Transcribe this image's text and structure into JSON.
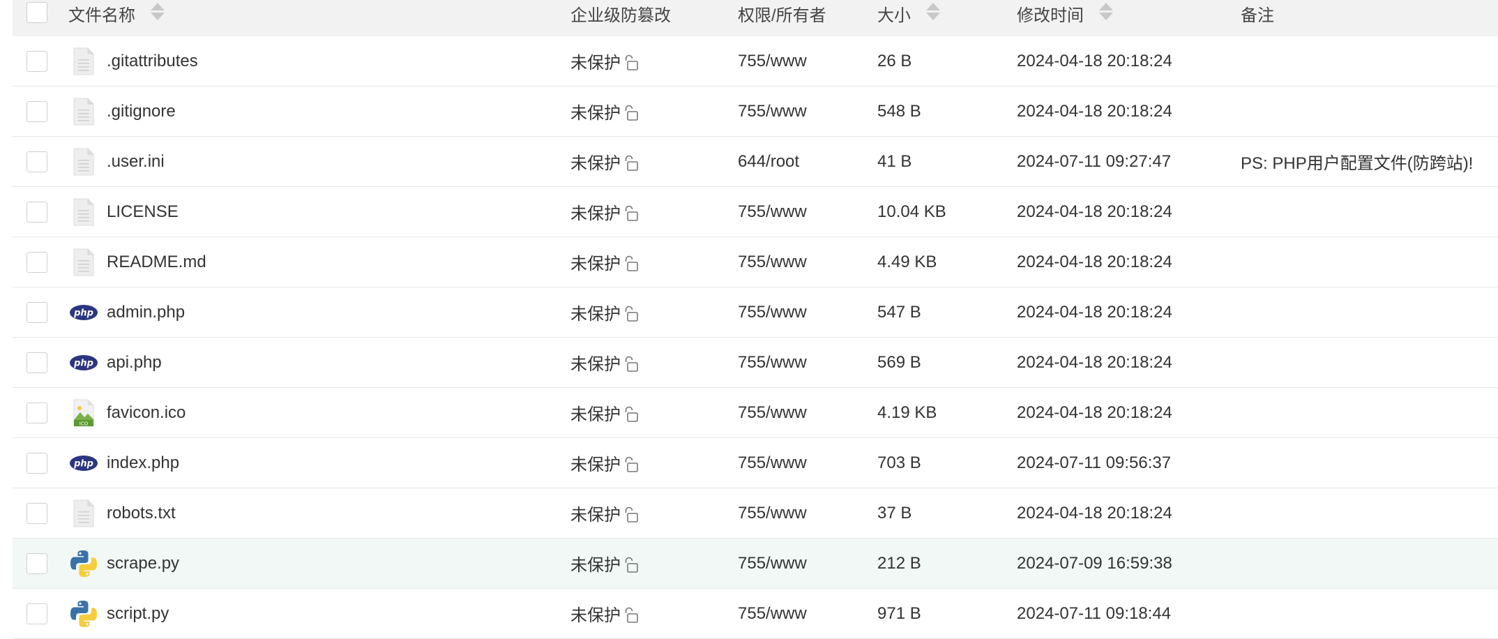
{
  "header": {
    "name": "文件名称",
    "protection": "企业级防篡改",
    "permission": "权限/所有者",
    "size": "大小",
    "modified": "修改时间",
    "note": "备注"
  },
  "files": [
    {
      "name": ".gitattributes",
      "icon": "text-file-icon",
      "protection": "未保护",
      "permission": "755/www",
      "size": "26 B",
      "modified": "2024-04-18 20:18:24",
      "note": ""
    },
    {
      "name": ".gitignore",
      "icon": "text-file-icon",
      "protection": "未保护",
      "permission": "755/www",
      "size": "548 B",
      "modified": "2024-04-18 20:18:24",
      "note": ""
    },
    {
      "name": ".user.ini",
      "icon": "text-file-icon",
      "protection": "未保护",
      "permission": "644/root",
      "size": "41 B",
      "modified": "2024-07-11 09:27:47",
      "note": "PS: PHP用户配置文件(防跨站)!"
    },
    {
      "name": "LICENSE",
      "icon": "text-file-icon",
      "protection": "未保护",
      "permission": "755/www",
      "size": "10.04 KB",
      "modified": "2024-04-18 20:18:24",
      "note": ""
    },
    {
      "name": "README.md",
      "icon": "text-file-icon",
      "protection": "未保护",
      "permission": "755/www",
      "size": "4.49 KB",
      "modified": "2024-04-18 20:18:24",
      "note": ""
    },
    {
      "name": "admin.php",
      "icon": "php-file-icon",
      "protection": "未保护",
      "permission": "755/www",
      "size": "547 B",
      "modified": "2024-04-18 20:18:24",
      "note": ""
    },
    {
      "name": "api.php",
      "icon": "php-file-icon",
      "protection": "未保护",
      "permission": "755/www",
      "size": "569 B",
      "modified": "2024-04-18 20:18:24",
      "note": ""
    },
    {
      "name": "favicon.ico",
      "icon": "ico-image-icon",
      "protection": "未保护",
      "permission": "755/www",
      "size": "4.19 KB",
      "modified": "2024-04-18 20:18:24",
      "note": ""
    },
    {
      "name": "index.php",
      "icon": "php-file-icon",
      "protection": "未保护",
      "permission": "755/www",
      "size": "703 B",
      "modified": "2024-07-11 09:56:37",
      "note": ""
    },
    {
      "name": "robots.txt",
      "icon": "text-file-icon",
      "protection": "未保护",
      "permission": "755/www",
      "size": "37 B",
      "modified": "2024-04-18 20:18:24",
      "note": ""
    },
    {
      "name": "scrape.py",
      "icon": "python-file-icon",
      "protection": "未保护",
      "permission": "755/www",
      "size": "212 B",
      "modified": "2024-07-09 16:59:38",
      "note": "",
      "highlighted": true
    },
    {
      "name": "script.py",
      "icon": "python-file-icon",
      "protection": "未保护",
      "permission": "755/www",
      "size": "971 B",
      "modified": "2024-07-11 09:18:44",
      "note": ""
    }
  ],
  "colors": {
    "header_bg": "#f2f2f2",
    "row_highlight_bg": "#f1f8f5",
    "php_badge": "#2b3580",
    "python_blue": "#3a72a8",
    "python_yellow": "#f5cd3d"
  }
}
